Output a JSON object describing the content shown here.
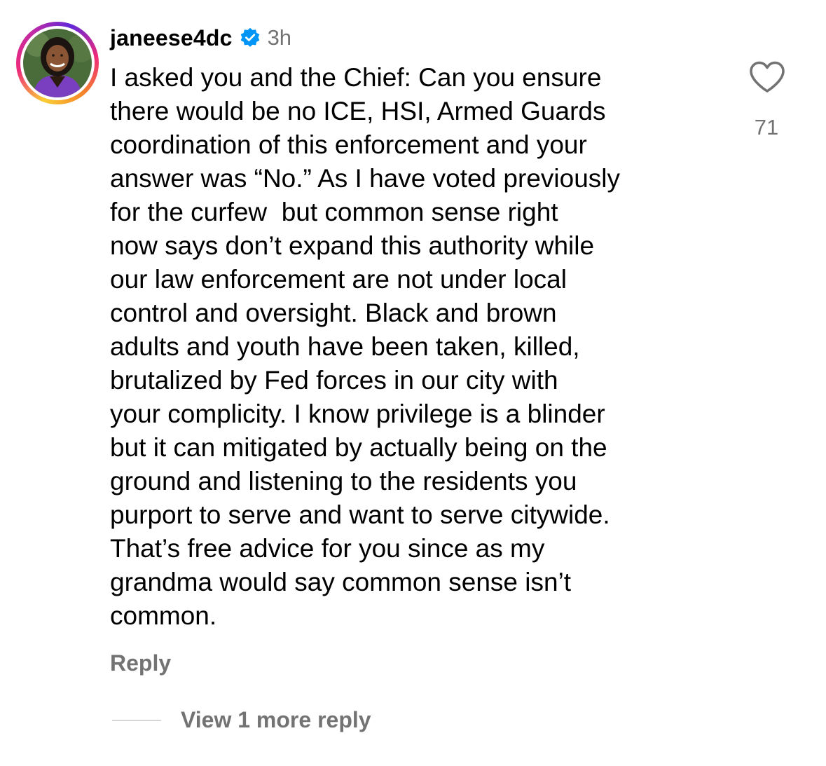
{
  "comment": {
    "username": "janeese4dc",
    "verified_icon": "verified-badge-icon",
    "timestamp": "3h",
    "text_lines": [
      "I asked you and the Chief: Can you ensure",
      "there would be no ICE, HSI, Armed Guards",
      "coordination of this enforcement and your",
      "answer was “No.” As I have voted previously",
      "for the curfew  but common sense right",
      "now says don’t expand this authority while",
      "our law enforcement are not under local",
      "control and oversight. Black and brown",
      "adults and youth have been taken, killed,",
      "brutalized by Fed forces in our city with",
      "your complicity. I know privilege is a blinder",
      "but it can mitigated by actually being on the",
      "ground and listening to the residents you",
      "purport to serve and want to serve citywide.",
      "That’s free advice for you since as my",
      "grandma would say common sense isn’t",
      "common."
    ],
    "like_icon": "heart-outline-icon",
    "like_count": "71",
    "reply_label": "Reply",
    "view_more_label": "View 1 more reply"
  },
  "colors": {
    "text_primary": "#000000",
    "text_secondary": "#737373",
    "verified_blue": "#0095f6",
    "divider": "#d6d6d6"
  }
}
